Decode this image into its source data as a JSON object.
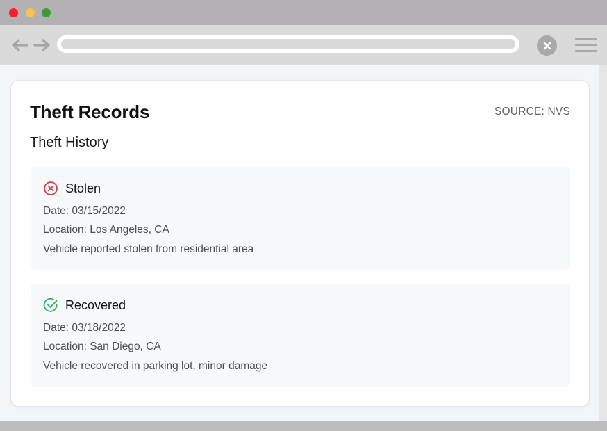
{
  "browser": {
    "window_controls": [
      "close",
      "minimize",
      "maximize"
    ],
    "icons": {
      "back": "arrow-left-icon",
      "forward": "arrow-right-icon",
      "close": "close-icon",
      "menu": "hamburger-menu-icon"
    }
  },
  "page": {
    "title": "Theft Records",
    "source": "SOURCE: NVS",
    "subtitle": "Theft History",
    "records": [
      {
        "status": "Stolen",
        "status_icon": "x-circle-icon",
        "status_color": "#e0363f",
        "date": "Date: 03/15/2022",
        "location": "Location: Los Angeles, CA",
        "description": "Vehicle reported stolen from residential area"
      },
      {
        "status": "Recovered",
        "status_icon": "check-circle-icon",
        "status_color": "#22b456",
        "date": "Date: 03/18/2022",
        "location": "Location: San Diego, CA",
        "description": "Vehicle recovered in parking lot, minor damage"
      }
    ]
  }
}
